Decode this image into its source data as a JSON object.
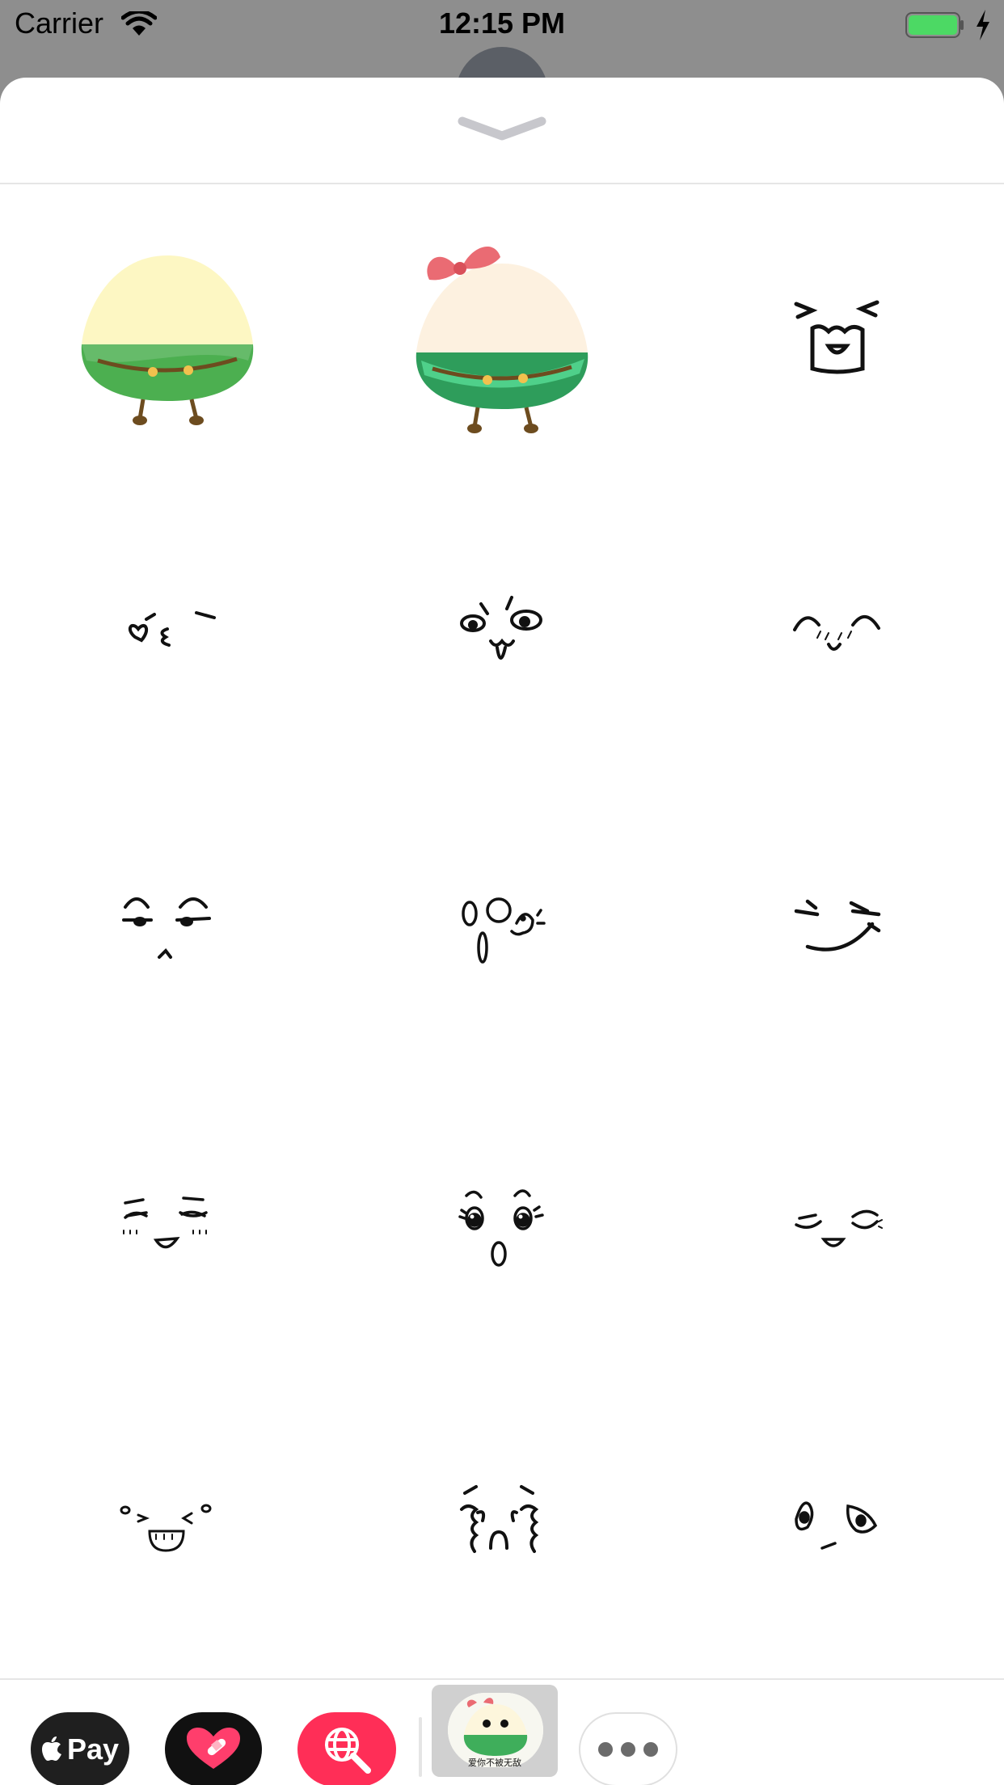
{
  "status_bar": {
    "carrier": "Carrier",
    "time": "12:15 PM",
    "battery_color": "#4cd964"
  },
  "sheet": {
    "collapse_icon": "chevron-down-icon"
  },
  "stickers": [
    {
      "name": "zongzi-green-sticker"
    },
    {
      "name": "zongzi-bow-sticker"
    },
    {
      "name": "squint-grin-face-sticker"
    },
    {
      "name": "heart-eye-face-sticker"
    },
    {
      "name": "tongue-out-face-sticker"
    },
    {
      "name": "blushing-closed-eyes-face-sticker"
    },
    {
      "name": "smug-face-sticker"
    },
    {
      "name": "surprised-ghost-face-sticker"
    },
    {
      "name": "smirk-face-sticker"
    },
    {
      "name": "laughing-blush-face-sticker"
    },
    {
      "name": "sparkly-eyes-surprised-face-sticker"
    },
    {
      "name": "content-smile-face-sticker"
    },
    {
      "name": "happy-laugh-face-sticker"
    },
    {
      "name": "crying-face-sticker"
    },
    {
      "name": "wide-eyed-face-sticker"
    }
  ],
  "app_tray": {
    "apple_pay_label": "Pay",
    "apps": [
      "apple-pay",
      "heart-stickers",
      "web-search",
      "zongzi-sticker-pack",
      "more"
    ],
    "selected_app_caption": "爱你不被无敌",
    "accent_colors": {
      "search": "#ff2e57",
      "selected_bg": "#d0d0d0"
    }
  }
}
